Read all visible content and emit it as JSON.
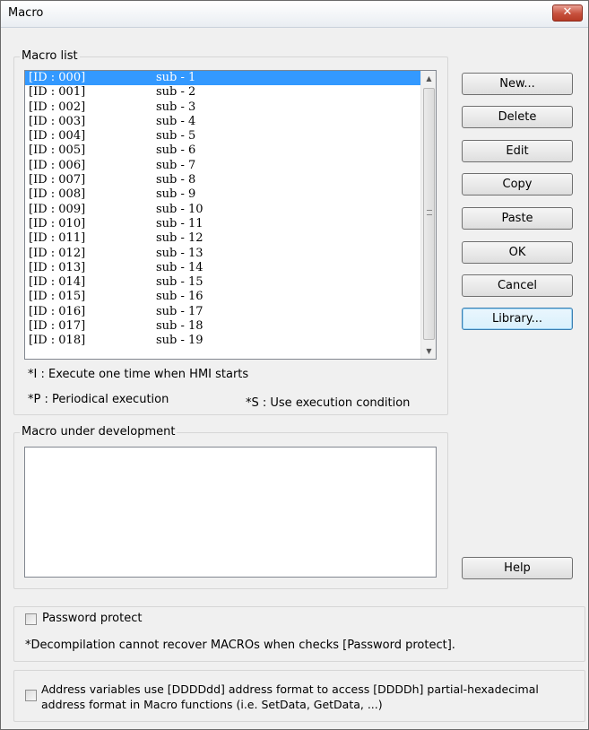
{
  "window": {
    "title": "Macro",
    "close_glyph": "✕"
  },
  "macro_list": {
    "label": "Macro list",
    "rows": [
      {
        "id": "[ID : 000]",
        "name": "sub - 1"
      },
      {
        "id": "[ID : 001]",
        "name": "sub - 2"
      },
      {
        "id": "[ID : 002]",
        "name": "sub - 3"
      },
      {
        "id": "[ID : 003]",
        "name": "sub - 4"
      },
      {
        "id": "[ID : 004]",
        "name": "sub - 5"
      },
      {
        "id": "[ID : 005]",
        "name": "sub - 6"
      },
      {
        "id": "[ID : 006]",
        "name": "sub - 7"
      },
      {
        "id": "[ID : 007]",
        "name": "sub - 8"
      },
      {
        "id": "[ID : 008]",
        "name": "sub - 9"
      },
      {
        "id": "[ID : 009]",
        "name": "sub - 10"
      },
      {
        "id": "[ID : 010]",
        "name": "sub - 11"
      },
      {
        "id": "[ID : 011]",
        "name": "sub - 12"
      },
      {
        "id": "[ID : 012]",
        "name": "sub - 13"
      },
      {
        "id": "[ID : 013]",
        "name": "sub - 14"
      },
      {
        "id": "[ID : 014]",
        "name": "sub - 15"
      },
      {
        "id": "[ID : 015]",
        "name": "sub - 16"
      },
      {
        "id": "[ID : 016]",
        "name": "sub - 17"
      },
      {
        "id": "[ID : 017]",
        "name": "sub - 18"
      },
      {
        "id": "[ID : 018]",
        "name": "sub - 19"
      }
    ],
    "selected_index": 0,
    "note_i": "*I : Execute one time when HMI starts",
    "note_p": "*P : Periodical execution",
    "note_s": "*S : Use execution condition"
  },
  "buttons": {
    "new": "New...",
    "delete": "Delete",
    "edit": "Edit",
    "copy": "Copy",
    "paste": "Paste",
    "ok": "OK",
    "cancel": "Cancel",
    "library": "Library...",
    "help": "Help"
  },
  "development": {
    "label": "Macro under development"
  },
  "password": {
    "label": "Password protect",
    "checked": false,
    "note": "*Decompilation cannot recover MACROs when checks [Password protect]."
  },
  "address": {
    "label_line1": "Address variables use [DDDDdd] address format to access [DDDDh] partial-hexadecimal",
    "label_line2": "address format in Macro functions (i.e. SetData, GetData, ...)",
    "checked": false
  },
  "colors": {
    "selection": "#3399ff",
    "window_bg": "#f0f0f0"
  },
  "icons": {
    "scroll_up": "▲",
    "scroll_down": "▼"
  }
}
